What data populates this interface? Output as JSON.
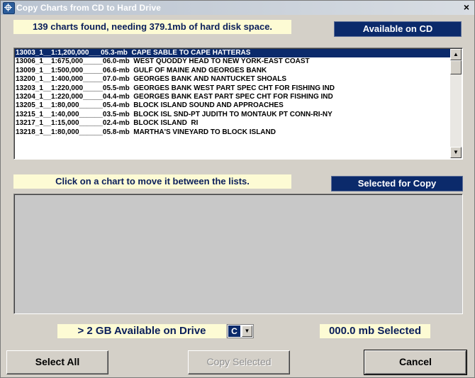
{
  "window": {
    "title": "Copy Charts from CD to Hard Drive",
    "close_glyph": "×"
  },
  "summary": "139 charts found, needing 379.1mb of hard disk space.",
  "available_header": "Available on CD",
  "available_list": [
    "13003_1__1:1,200,000___05.3-mb  CAPE SABLE TO CAPE HATTERAS",
    "13006_1__1:675,000_____06.0-mb  WEST QUODDY HEAD TO NEW YORK-EAST COAST",
    "13009_1__1:500,000_____06.6-mb  GULF OF MAINE AND GEORGES BANK",
    "13200_1__1:400,000_____07.0-mb  GEORGES BANK AND NANTUCKET SHOALS",
    "13203_1__1:220,000_____05.5-mb  GEORGES BANK WEST PART SPEC CHT FOR FISHING IND",
    "13204_1__1:220,000_____04.4-mb  GEORGES BANK EAST PART SPEC CHT FOR FISHING IND",
    "13205_1__1:80,000______05.4-mb  BLOCK ISLAND SOUND AND APPROACHES",
    "13215_1__1:40,000______03.5-mb  BLOCK ISL SND-PT JUDITH TO MONTAUK PT CONN-RI-NY",
    "13217_1__1:15,000______02.4-mb  BLOCK ISLAND  RI",
    "13218_1__1:80,000______05.8-mb  MARTHA'S VINEYARD TO BLOCK ISLAND"
  ],
  "instructions": "Click on a chart to move it between the lists.",
  "selected_header": "Selected for Copy",
  "selected_list": [],
  "drive": {
    "space_label": "> 2  GB Available on Drive",
    "letter": "C",
    "selected_size": "000.0 mb Selected"
  },
  "buttons": {
    "select_all": "Select All",
    "copy_selected": "Copy Selected",
    "cancel": "Cancel"
  },
  "icons": {
    "scroll_up": "▲",
    "scroll_down": "▼",
    "dropdown": "▼",
    "app": "ship-wheel-icon"
  },
  "colors": {
    "accent": "#0b2a6b",
    "label_bg": "#fdfbd4",
    "dialog": "#d4d0c8"
  }
}
